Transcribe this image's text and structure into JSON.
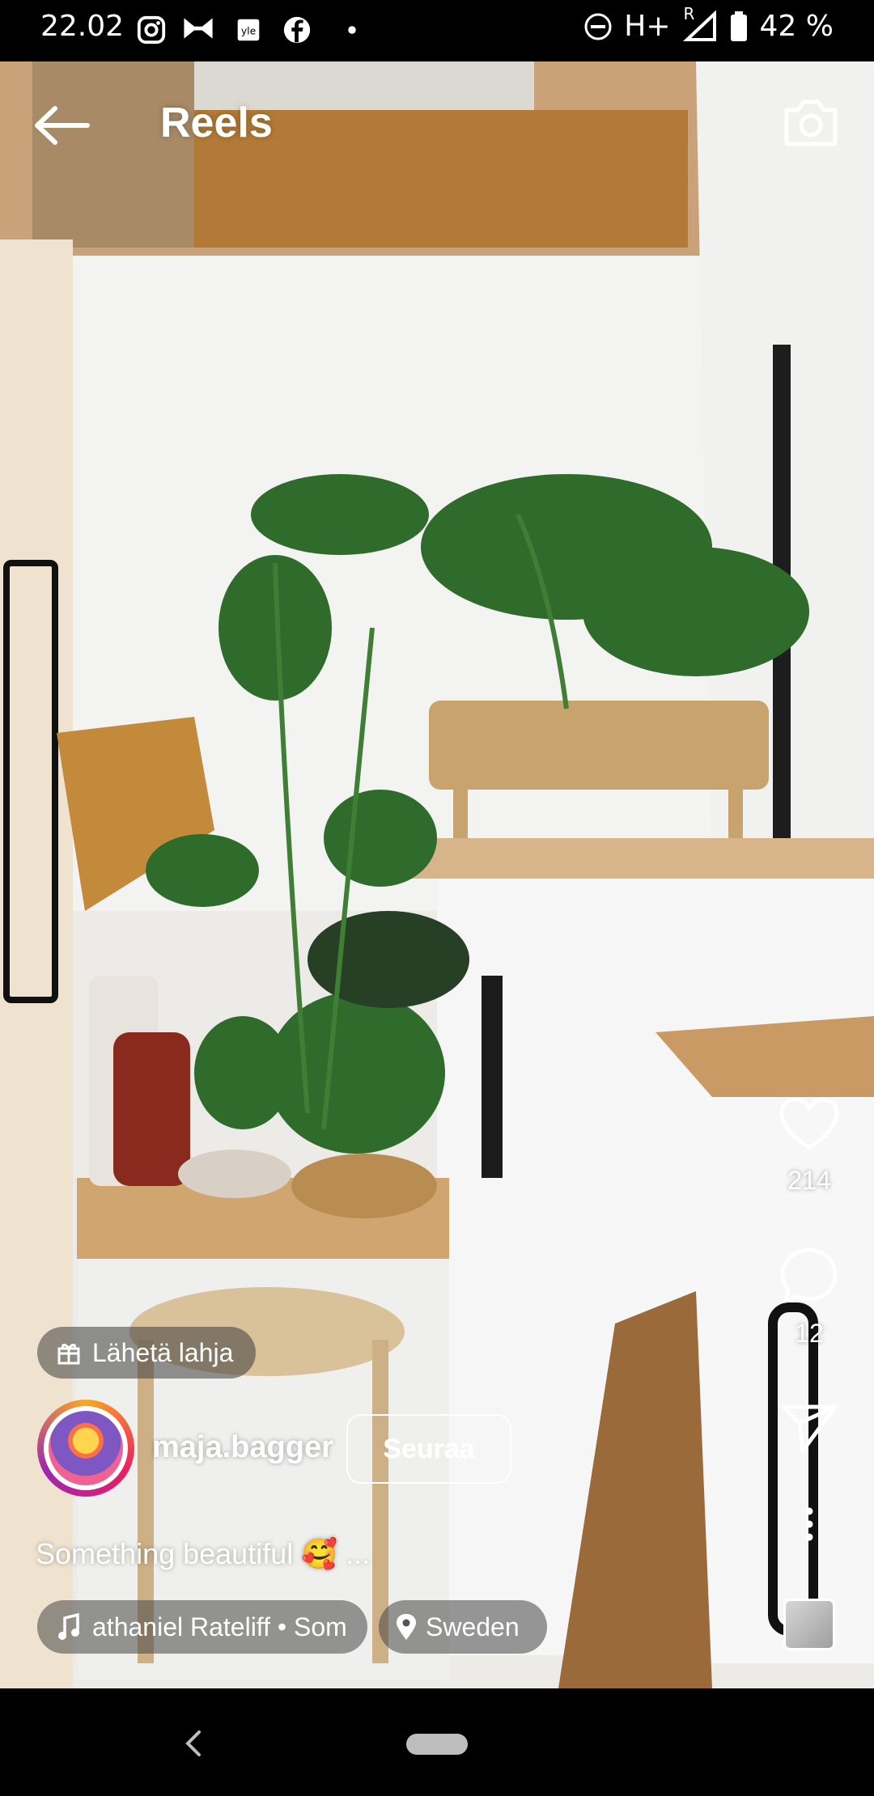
{
  "status_bar": {
    "time": "22.02",
    "network": "H+",
    "roaming": "R",
    "battery": "42 %"
  },
  "header": {
    "title": "Reels"
  },
  "actions": {
    "likes": "214",
    "comments": "12"
  },
  "gift": {
    "label": "Lähetä lahja"
  },
  "author": {
    "username": "maja.bagger",
    "follow_label": "Seuraa"
  },
  "caption": {
    "text": "Something beautiful 🥰 ..."
  },
  "audio": {
    "label": "athaniel Rateliff • Som"
  },
  "location": {
    "label": "Sweden"
  },
  "icons": {
    "back": "arrow-left-icon",
    "camera": "camera-icon",
    "like": "heart-icon",
    "comment": "comment-icon",
    "share": "send-icon",
    "more": "more-vertical-icon",
    "gift": "gift-icon",
    "music": "music-note-icon",
    "location": "location-pin-icon"
  }
}
